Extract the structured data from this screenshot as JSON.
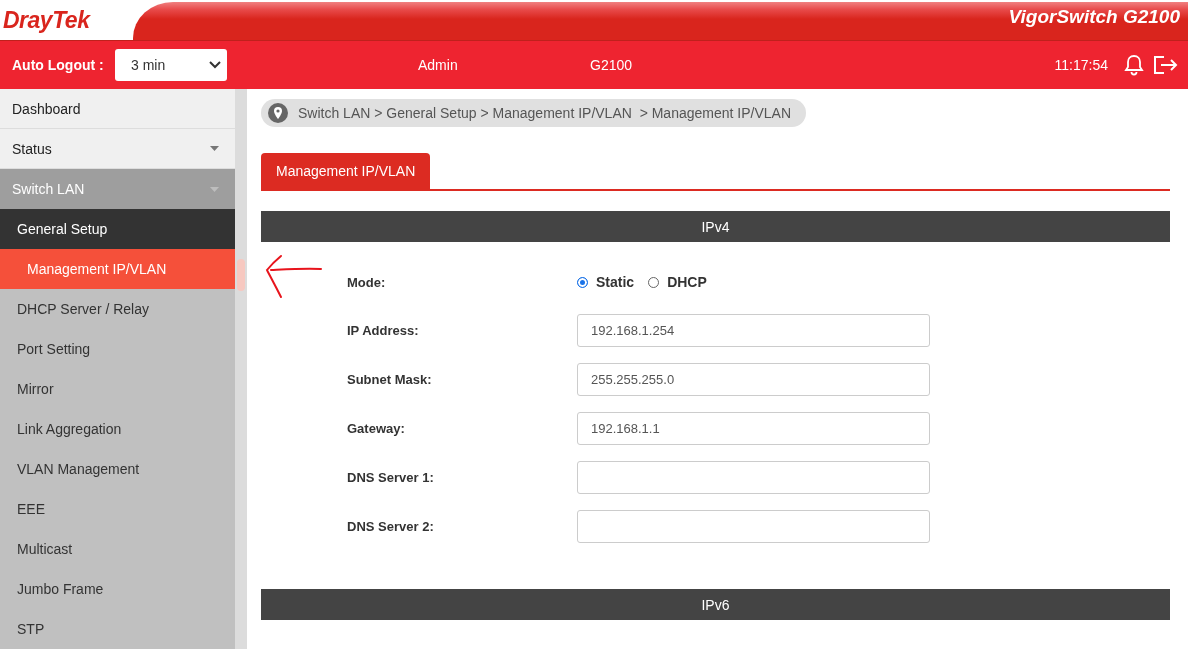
{
  "banner": {
    "logo": "DrayTek",
    "product": "VigorSwitch G2100"
  },
  "header": {
    "auto_logout_label": "Auto Logout :",
    "auto_logout_value": "3 min",
    "user": "Admin",
    "model": "G2100",
    "time": "11:17:54"
  },
  "sidebar": {
    "items": [
      {
        "label": "Dashboard"
      },
      {
        "label": "Status",
        "expanded": false
      },
      {
        "label": "Switch LAN",
        "expanded": true,
        "children": [
          {
            "label": "General Setup",
            "selected": false,
            "children": [
              {
                "label": "Management IP/VLAN",
                "selected": true
              }
            ]
          },
          {
            "label": "DHCP Server / Relay",
            "selected": false
          },
          {
            "label": "Port Setting",
            "selected": false
          },
          {
            "label": "Mirror",
            "selected": false
          },
          {
            "label": "Link Aggregation",
            "selected": false
          },
          {
            "label": "VLAN Management",
            "selected": false
          },
          {
            "label": "EEE",
            "selected": false
          },
          {
            "label": "Multicast",
            "selected": false
          },
          {
            "label": "Jumbo Frame",
            "selected": false
          },
          {
            "label": "STP",
            "selected": false
          }
        ]
      }
    ]
  },
  "breadcrumb": "Switch LAN > General Setup > Management IP/VLAN  > Management IP/VLAN",
  "tabs": [
    {
      "label": "Management IP/VLAN",
      "selected": true
    }
  ],
  "sections": [
    {
      "title": "IPv4",
      "fields": [
        {
          "kind": "radio",
          "label": "Mode:",
          "options": [
            {
              "label": "Static",
              "selected": true
            },
            {
              "label": "DHCP",
              "selected": false
            }
          ]
        },
        {
          "kind": "text",
          "label": "IP Address:",
          "value": "192.168.1.254"
        },
        {
          "kind": "text",
          "label": "Subnet Mask:",
          "value": "255.255.255.0"
        },
        {
          "kind": "text",
          "label": "Gateway:",
          "value": "192.168.1.1"
        },
        {
          "kind": "text",
          "label": "DNS Server 1:"
        },
        {
          "kind": "text",
          "label": "DNS Server 2:"
        }
      ]
    },
    {
      "title": "IPv6"
    }
  ]
}
